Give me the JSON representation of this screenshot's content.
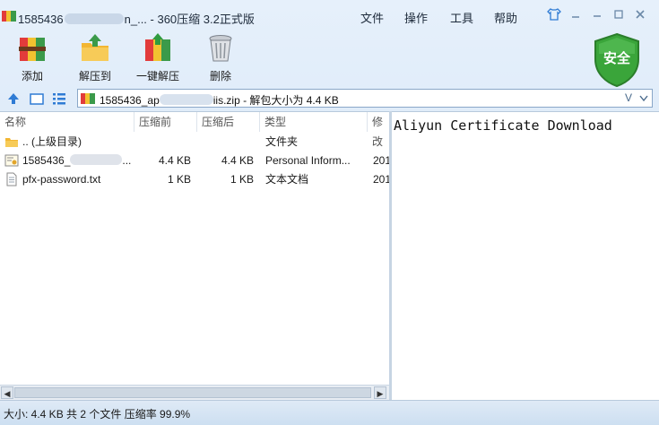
{
  "window": {
    "title_prefix": "1585436",
    "title_mid": "n_...",
    "title_suffix": " - 360压缩 3.2正式版",
    "menu": [
      "文件",
      "操作",
      "工具",
      "帮助"
    ]
  },
  "toolbar": {
    "add": "添加",
    "extract_to": "解压到",
    "one_click_extract": "一键解压",
    "delete": "删除",
    "security_badge": "安全"
  },
  "address": {
    "prefix": "1585436_ap",
    "suffix": "iis.zip - 解包大小为 4.4 KB",
    "dropdown": "V"
  },
  "columns": [
    "名称",
    "压缩前",
    "压缩后",
    "类型",
    "修改"
  ],
  "files": [
    {
      "name": ".. (上级目录)",
      "before": "",
      "after": "",
      "type": "文件夹",
      "modified": "",
      "icon": "folder-up-icon"
    },
    {
      "name": "1585436_",
      "name_tail": "...",
      "before": "4.4 KB",
      "after": "4.4 KB",
      "type": "Personal Inform...",
      "modified": "201",
      "icon": "certificate-icon"
    },
    {
      "name": "pfx-password.txt",
      "before": "1 KB",
      "after": "1 KB",
      "type": "文本文档",
      "modified": "201",
      "icon": "text-file-icon"
    }
  ],
  "preview": {
    "text": "Aliyun Certificate Download"
  },
  "status": {
    "text": "大小: 4.4 KB 共 2 个文件 压缩率 99.9%"
  },
  "colors": {
    "accent": "#2f7bd4",
    "shield_green": "#3aa53a"
  }
}
